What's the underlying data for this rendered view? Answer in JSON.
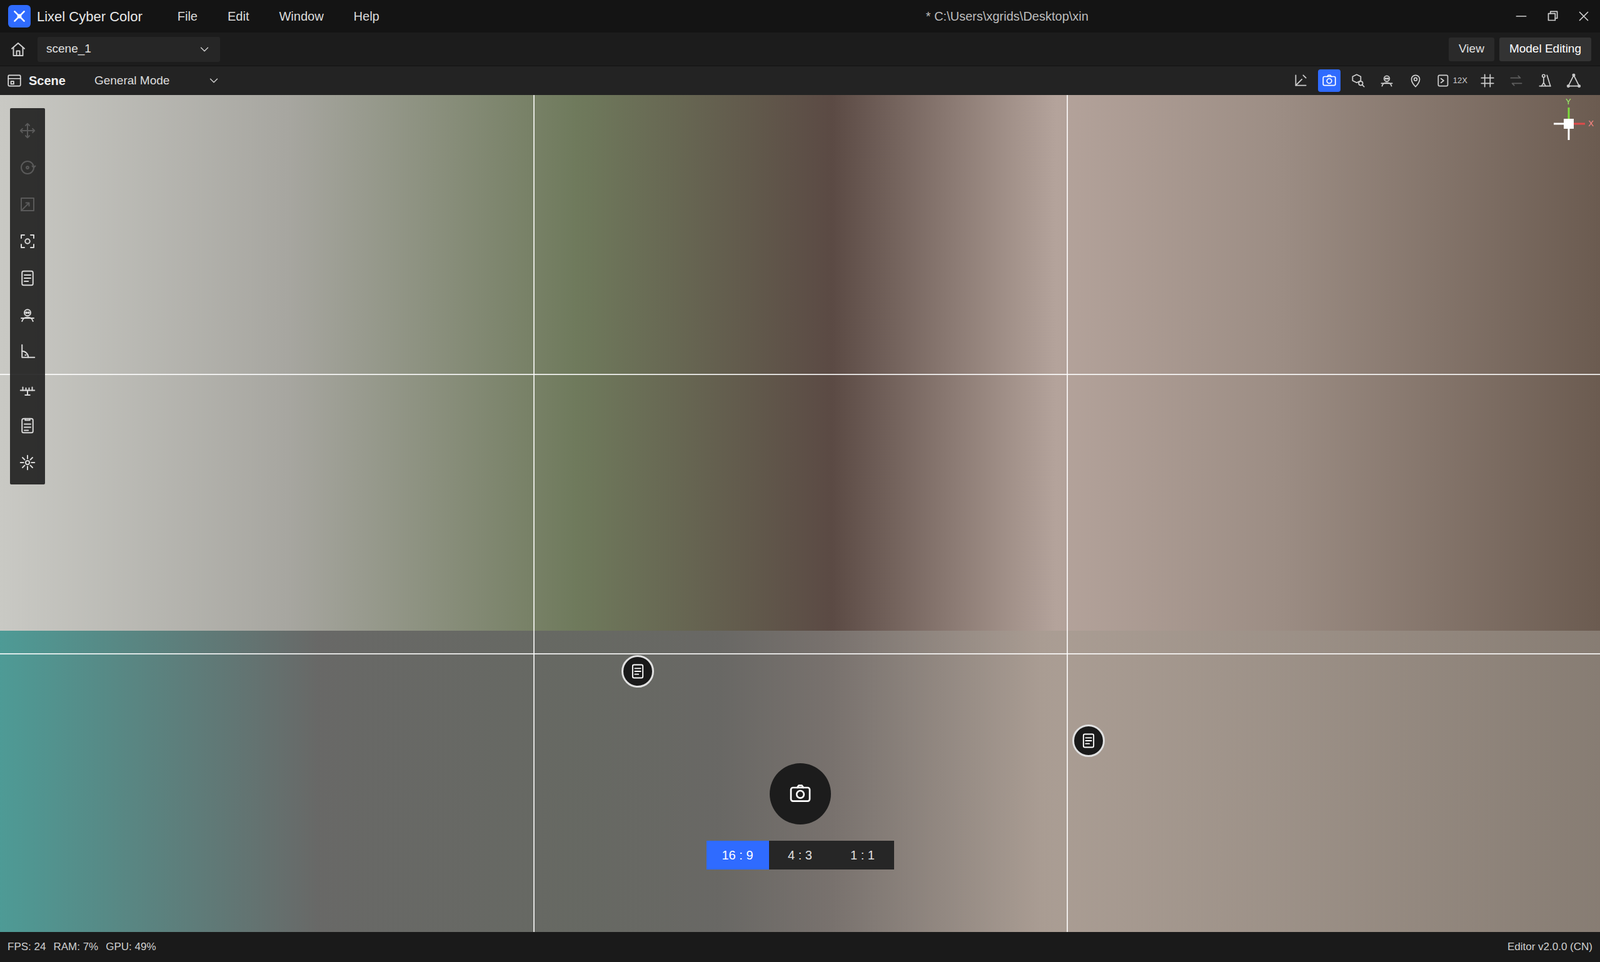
{
  "window": {
    "app_name": "Lixel Cyber Color",
    "path": "* C:\\Users\\xgrids\\Desktop\\xin"
  },
  "menu": [
    "File",
    "Edit",
    "Window",
    "Help"
  ],
  "scene_select": {
    "value": "scene_1"
  },
  "mode_buttons": [
    {
      "label": "View",
      "selected": false
    },
    {
      "label": "Model Editing",
      "selected": true
    }
  ],
  "panel": {
    "title": "Scene",
    "mode": "General Mode"
  },
  "view_tools": [
    {
      "kind": "axis",
      "selected": false,
      "disabled": false
    },
    {
      "kind": "camera",
      "selected": true,
      "disabled": false
    },
    {
      "kind": "search",
      "selected": false,
      "disabled": false
    },
    {
      "kind": "robot",
      "selected": false,
      "disabled": false
    },
    {
      "kind": "pin",
      "selected": false,
      "disabled": false
    },
    {
      "kind": "speed",
      "selected": false,
      "disabled": false,
      "label": "12X"
    },
    {
      "kind": "grid",
      "selected": false,
      "disabled": false
    },
    {
      "kind": "swap",
      "selected": false,
      "disabled": true
    },
    {
      "kind": "person",
      "selected": false,
      "disabled": false
    },
    {
      "kind": "triangle",
      "selected": false,
      "disabled": false
    }
  ],
  "left_tools": [
    {
      "kind": "move",
      "disabled": true
    },
    {
      "kind": "rotate",
      "disabled": true
    },
    {
      "kind": "scale",
      "disabled": true
    },
    {
      "kind": "focus",
      "disabled": false
    },
    {
      "kind": "note",
      "disabled": false
    },
    {
      "kind": "robot",
      "disabled": false
    },
    {
      "kind": "angle",
      "disabled": false
    },
    {
      "kind": "measure",
      "disabled": false
    },
    {
      "kind": "list",
      "disabled": false
    },
    {
      "kind": "sun",
      "disabled": false
    }
  ],
  "annotations": [
    {
      "kind": "note"
    },
    {
      "kind": "note"
    }
  ],
  "capture": {
    "ratios": [
      {
        "label": "16 : 9",
        "selected": true
      },
      {
        "label": "4 : 3",
        "selected": false
      },
      {
        "label": "1 : 1",
        "selected": false
      }
    ]
  },
  "gizmo": {
    "labels": [
      "Y",
      "X"
    ]
  },
  "status_bar": {
    "fps": "FPS: 24",
    "ram": "RAM: 7%",
    "gpu": "GPU: 49%",
    "version": "Editor v2.0.0 (CN)"
  }
}
